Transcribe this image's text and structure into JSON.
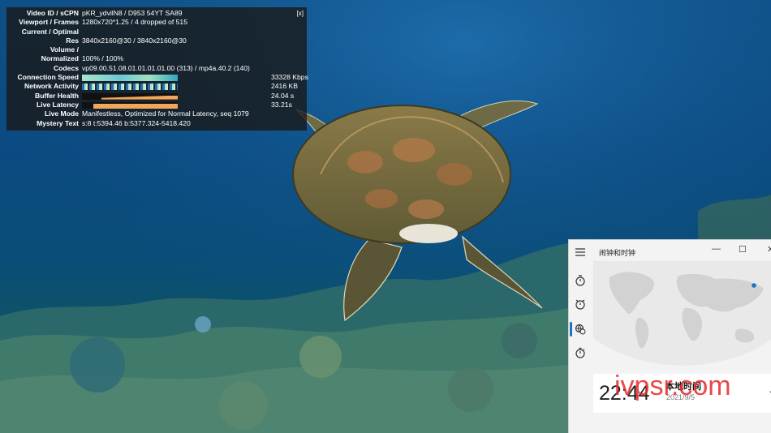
{
  "stats": {
    "close_label": "[x]",
    "rows": [
      {
        "key": "Video ID / sCPN",
        "value": "pKR_ydvilN8 / D953 54YT SA89"
      },
      {
        "key": "Viewport / Frames",
        "value": "1280x720*1.25 / 4 dropped of 515"
      },
      {
        "key": "Current / Optimal",
        "value": ""
      },
      {
        "key": "Res",
        "value": "3840x2160@30 / 3840x2160@30"
      },
      {
        "key": "Volume /",
        "value": ""
      },
      {
        "key": "Normalized",
        "value": "100% / 100%"
      },
      {
        "key": "Codecs",
        "value": "vp09.00.51.08.01.01.01.01.00 (313) / mp4a.40.2 (140)"
      },
      {
        "key": "Connection Speed",
        "value": "33328 Kbps"
      },
      {
        "key": "Network Activity",
        "value": "2416 KB"
      },
      {
        "key": "Buffer Health",
        "value": "24.04 s"
      },
      {
        "key": "Live Latency",
        "value": "33.21s"
      },
      {
        "key": "Live Mode",
        "value": "Manifestless, Optimized for Normal Latency, seq 1079"
      },
      {
        "key": "Mystery Text",
        "value": "s:8 t:5394.46 b:5377.324-5418.420"
      }
    ]
  },
  "clock_app": {
    "title": "闹钟和时钟",
    "window_controls": {
      "minimize": "—",
      "maximize": "☐",
      "close": "✕"
    },
    "nav_icons": [
      "hamburger-icon",
      "timer-icon",
      "alarm-icon",
      "world-clock-icon",
      "stopwatch-icon"
    ],
    "selected_nav": "world-clock-icon",
    "local_time": "22:44",
    "local_label": "本地时间",
    "local_date": "2021/9/5",
    "chevron": "⌄",
    "accent_color": "#1a73c8"
  },
  "watermark": "ivpsr.com"
}
